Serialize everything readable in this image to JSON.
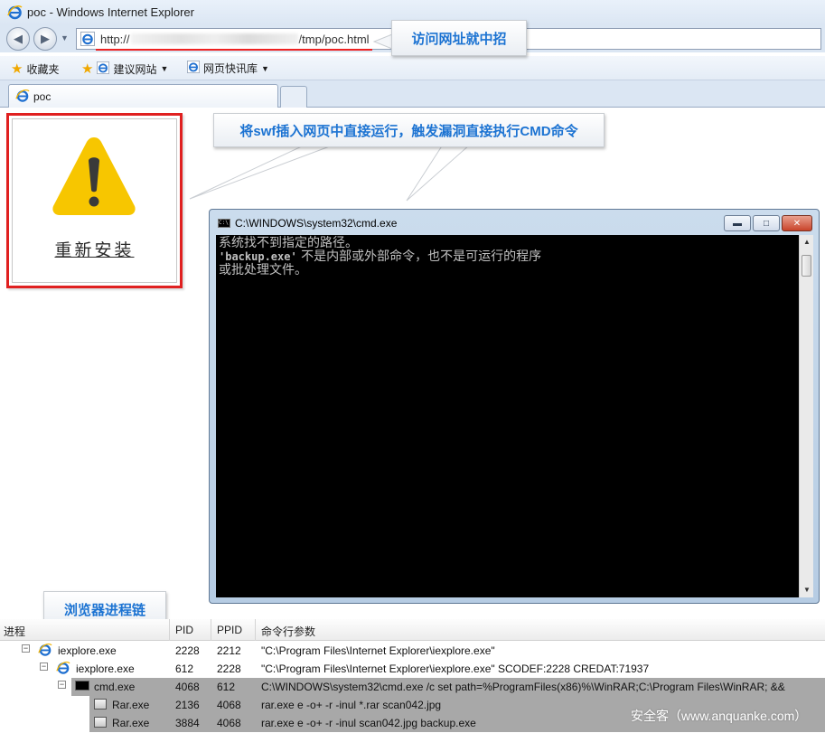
{
  "window": {
    "title": "poc - Windows Internet Explorer",
    "address": {
      "prefix": "http://",
      "suffix": "/tmp/poc.html"
    }
  },
  "favorites": {
    "favorites_label": "收藏夹",
    "suggested_sites": "建议网站",
    "web_slices": "网页快讯库"
  },
  "tab": {
    "label": "poc"
  },
  "page": {
    "reinstall_label": "重新安装"
  },
  "callouts": {
    "visit": "访问网址就中招",
    "swf": "将swf插入网页中直接运行，触发漏洞直接执行CMD命令",
    "chain": "浏览器进程链"
  },
  "cmd_window": {
    "title": "C:\\WINDOWS\\system32\\cmd.exe",
    "lines": [
      {
        "text": "系统找不到指定的路径。"
      },
      {
        "mono": "'backup.exe'",
        "text": " 不是内部或外部命令，也不是可运行的程序"
      },
      {
        "text": "或批处理文件。"
      }
    ]
  },
  "process_table": {
    "headers": {
      "process": "进程",
      "pid": "PID",
      "ppid": "PPID",
      "cmdline": "命令行参数"
    },
    "rows": [
      {
        "name": "iexplore.exe",
        "pid": "2228",
        "ppid": "2212",
        "cmd": "\"C:\\Program Files\\Internet Explorer\\iexplore.exe\""
      },
      {
        "name": "iexplore.exe",
        "pid": "612",
        "ppid": "2228",
        "cmd": "\"C:\\Program Files\\Internet Explorer\\iexplore.exe\" SCODEF:2228 CREDAT:71937"
      },
      {
        "name": "cmd.exe",
        "pid": "4068",
        "ppid": "612",
        "cmd": "C:\\WINDOWS\\system32\\cmd.exe /c set path=%ProgramFiles(x86)%\\WinRAR;C:\\Program Files\\WinRAR; &&"
      },
      {
        "name": "Rar.exe",
        "pid": "2136",
        "ppid": "4068",
        "cmd": "rar.exe  e -o+ -r -inul *.rar scan042.jpg"
      },
      {
        "name": "Rar.exe",
        "pid": "3884",
        "ppid": "4068",
        "cmd": "rar.exe  e -o+ -r -inul scan042.jpg backup.exe"
      }
    ]
  },
  "watermark": "安全客（www.anquanke.com）",
  "icons": {
    "browser": "ie-logo-icon",
    "warning": "warning-triangle-icon",
    "console": "console-icon",
    "archive": "rar-icon"
  },
  "colors": {
    "highlight_red": "#e02020",
    "callout_text": "#1c73d2",
    "warning_yellow": "#f7c600"
  }
}
